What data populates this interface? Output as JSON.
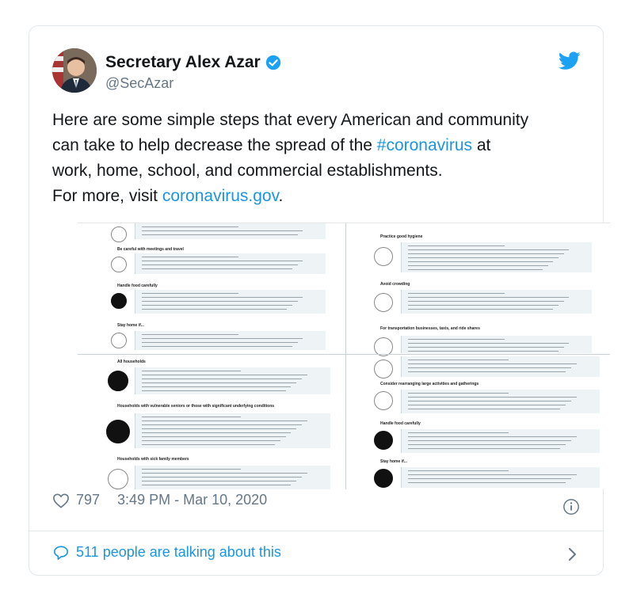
{
  "author": {
    "name": "Secretary Alex Azar",
    "handle": "@SecAzar",
    "verified": true
  },
  "tweet": {
    "line1": "Here are some simple steps that every American and community",
    "line2_pre": "can take to help decrease the spread of the ",
    "hashtag": "#coronavirus",
    "line2_post": " at",
    "line3": "work, home, school, and commercial establishments.",
    "line4_pre": "For more, visit ",
    "link": "coronavirus.gov",
    "line4_post": "."
  },
  "media": {
    "left_sections": [
      "Be careful with meetings and travel",
      "Handle food carefully",
      "Stay home if...",
      "All households",
      "Households with vulnerable seniors or those with significant underlying conditions",
      "Households with sick family members"
    ],
    "right_sections": [
      "Practice good hygiene",
      "Avoid crowding",
      "For transportation businesses, taxis, and ride shares",
      "Consider rearranging large activities and gatherings",
      "Handle food carefully",
      "Stay home if..."
    ]
  },
  "footer": {
    "likes": "797",
    "timestamp": "3:49 PM - Mar 10, 2020",
    "talking": "511 people are talking about this"
  },
  "colors": {
    "link": "#1b95e0",
    "muted": "#657786",
    "verified": "#1da1f2"
  },
  "icons": [
    "twitter-bird-icon",
    "verified-badge-icon",
    "heart-icon",
    "info-icon",
    "speech-bubble-icon",
    "chevron-right-icon"
  ]
}
